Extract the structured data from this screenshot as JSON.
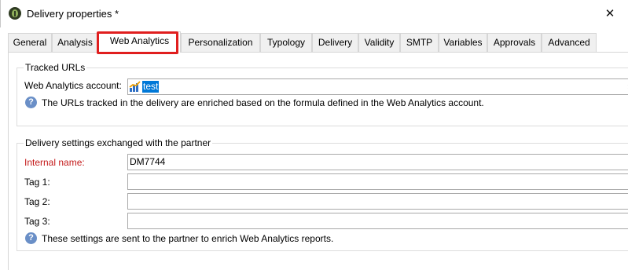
{
  "window": {
    "title": "Delivery properties *",
    "close_glyph": "✕"
  },
  "tabs": [
    {
      "label": "General"
    },
    {
      "label": "Analysis"
    },
    {
      "label": "Web Analytics",
      "active": true
    },
    {
      "label": "Personalization"
    },
    {
      "label": "Typology"
    },
    {
      "label": "Delivery"
    },
    {
      "label": "Validity"
    },
    {
      "label": "SMTP"
    },
    {
      "label": "Variables"
    },
    {
      "label": "Approvals"
    },
    {
      "label": "Advanced"
    }
  ],
  "tracked_urls": {
    "title": "Tracked URLs",
    "account_label": "Web Analytics account:",
    "account_value": "test",
    "info_text": "The URLs tracked in the delivery are enriched based on the formula defined in the Web Analytics account."
  },
  "partner_settings": {
    "title": "Delivery settings exchanged with the partner",
    "internal_name_label": "Internal name:",
    "internal_name_value": "DM7744",
    "tag1_label": "Tag 1:",
    "tag1_value": "",
    "tag2_label": "Tag 2:",
    "tag2_value": "",
    "tag3_label": "Tag 3:",
    "tag3_value": "",
    "info_text": "These settings are sent to the partner to enrich Web Analytics reports."
  },
  "colors": {
    "highlight": "#e01e1e",
    "required_label": "#c41a1a",
    "selection": "#0078d7"
  },
  "icons": {
    "app": "app-leaf-icon",
    "help": "help-icon",
    "analytics": "analytics-chart-icon"
  }
}
